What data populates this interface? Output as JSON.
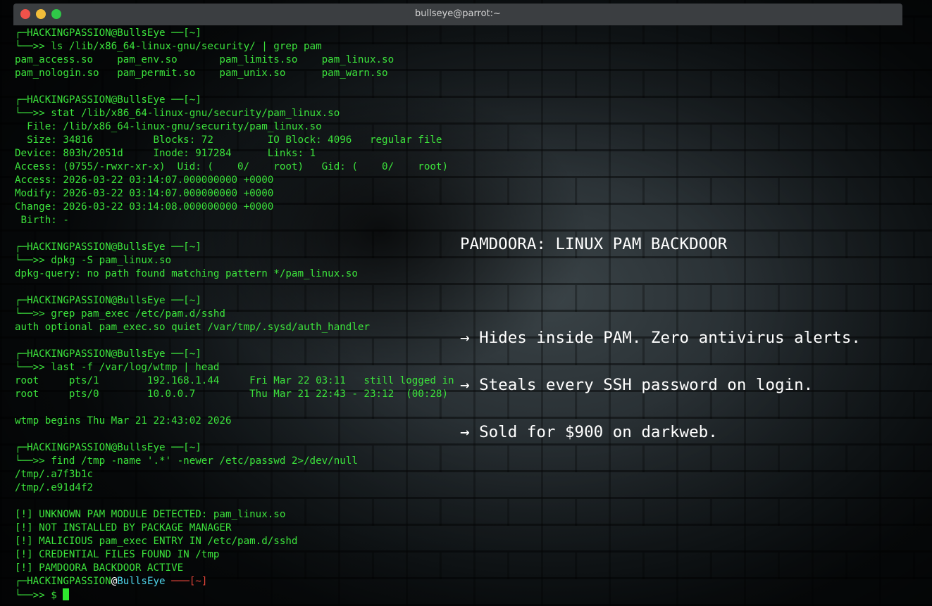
{
  "window": {
    "title": "bullseye@parrot:~"
  },
  "colors": {
    "terminal_text": "#3ce33c",
    "overlay_text": "#ffffff",
    "host": "#4fd6ec",
    "dir_active": "#e5453a",
    "close": "#f0524a",
    "minimize": "#f2bd3a",
    "maximize": "#2fc748"
  },
  "icons": [
    "close-button",
    "minimize-button",
    "maximize-button",
    "cursor-block"
  ],
  "prompt": {
    "header": "┌─HACKINGPASSION@BullsEye ──[~]",
    "arrow": "└──>> "
  },
  "blocks": [
    {
      "command": "ls /lib/x86_64-linux-gnu/security/ | grep pam",
      "output": [
        "pam_access.so    pam_env.so       pam_limits.so    pam_linux.so",
        "pam_nologin.so   pam_permit.so    pam_unix.so      pam_warn.so"
      ]
    },
    {
      "command": "stat /lib/x86_64-linux-gnu/security/pam_linux.so",
      "output": [
        "  File: /lib/x86_64-linux-gnu/security/pam_linux.so",
        "  Size: 34816          Blocks: 72         IO Block: 4096   regular file",
        "Device: 803h/2051d     Inode: 917284      Links: 1",
        "Access: (0755/-rwxr-xr-x)  Uid: (    0/    root)   Gid: (    0/    root)",
        "Access: 2026-03-22 03:14:07.000000000 +0000",
        "Modify: 2026-03-22 03:14:07.000000000 +0000",
        "Change: 2026-03-22 03:14:08.000000000 +0000",
        " Birth: -"
      ]
    },
    {
      "command": "dpkg -S pam_linux.so",
      "output": [
        "dpkg-query: no path found matching pattern */pam_linux.so"
      ]
    },
    {
      "command": "grep pam_exec /etc/pam.d/sshd",
      "output": [
        "auth optional pam_exec.so quiet /var/tmp/.sysd/auth_handler"
      ]
    },
    {
      "command": "last -f /var/log/wtmp | head",
      "output": [
        "root     pts/1        192.168.1.44     Fri Mar 22 03:11   still logged in",
        "root     pts/0        10.0.0.7         Thu Mar 21 22:43 - 23:12  (00:28)",
        "",
        "wtmp begins Thu Mar 21 22:43:02 2026"
      ]
    },
    {
      "command": "find /tmp -name '.*' -newer /etc/passwd 2>/dev/null",
      "output": [
        "/tmp/.a7f3b1c",
        "/tmp/.e91d4f2",
        "",
        "[!] UNKNOWN PAM MODULE DETECTED: pam_linux.so",
        "[!] NOT INSTALLED BY PACKAGE MANAGER",
        "[!] MALICIOUS pam_exec ENTRY IN /etc/pam.d/sshd",
        "[!] CREDENTIAL FILES FOUND IN /tmp",
        "[!] PAMDOORA BACKDOOR ACTIVE"
      ]
    }
  ],
  "final_prompt": {
    "corner": "┌─",
    "user": "HACKINGPASSION",
    "at": "@",
    "host": "BullsEye",
    "sep": " ──",
    "dir": "─[~]",
    "arrow": "└──>> ",
    "symbol": "$ "
  },
  "overlay": {
    "title": "PAMDOORA: LINUX PAM BACKDOOR",
    "items": [
      "→ Hides inside PAM. Zero antivirus alerts.",
      "→ Steals every SSH password on login.",
      "→ Sold for $900 on darkweb."
    ]
  }
}
